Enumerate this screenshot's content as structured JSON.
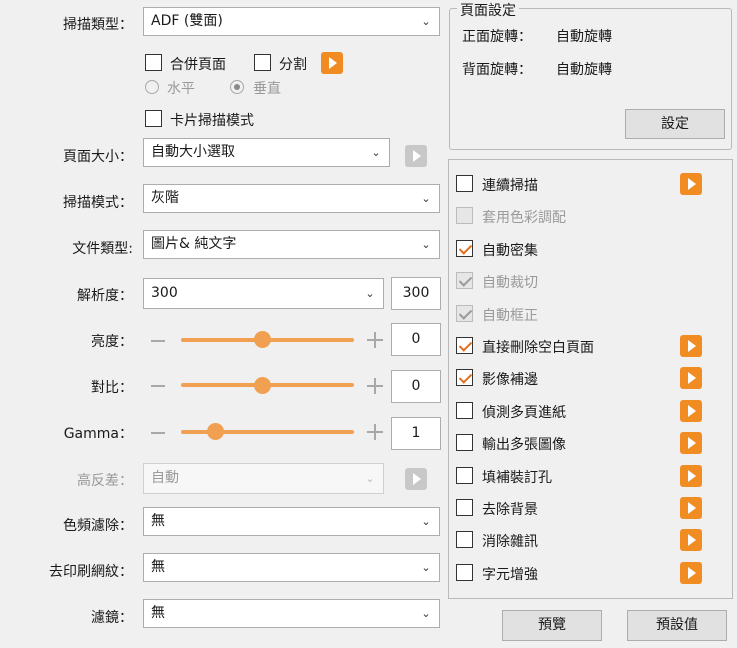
{
  "fields": {
    "scan_type": {
      "label": "掃描類型：",
      "value": "ADF (雙面)"
    },
    "page_size": {
      "label": "頁面大小：",
      "value": "自動大小選取"
    },
    "scan_mode": {
      "label": "掃描模式：",
      "value": "灰階"
    },
    "doc_type": {
      "label": "文件類型:",
      "value": "圖片& 純文字"
    },
    "resolution": {
      "label": "解析度：",
      "value": "300",
      "number": "300"
    },
    "brightness": {
      "label": "亮度：",
      "number": "0",
      "level_percent": 47
    },
    "contrast": {
      "label": "對比：",
      "number": "0",
      "level_percent": 47
    },
    "gamma": {
      "label": "Gamma：",
      "number": "1",
      "level_percent": 20
    },
    "high_contrast": {
      "label": "高反差：",
      "value": "自動"
    },
    "color_dropout": {
      "label": "色頻濾除：",
      "value": "無"
    },
    "descreen": {
      "label": "去印刷網紋：",
      "value": "無"
    },
    "filter": {
      "label": "濾鏡：",
      "value": "無"
    }
  },
  "options": {
    "merge_pages": "合併頁面",
    "split": "分割",
    "horizontal": "水平",
    "vertical": "垂直",
    "card_mode": "卡片掃描模式"
  },
  "page_setting": {
    "title": "頁面設定",
    "front_label": "正面旋轉：",
    "front_value": "自動旋轉",
    "back_label": "背面旋轉：",
    "back_value": "自動旋轉",
    "button": "設定"
  },
  "features": [
    {
      "label": "連續掃描",
      "checked": false,
      "disabled": false,
      "play": true
    },
    {
      "label": "套用色彩調配",
      "checked": false,
      "disabled": true,
      "play": false
    },
    {
      "label": "自動密集",
      "checked": true,
      "disabled": false,
      "play": false
    },
    {
      "label": "自動裁切",
      "checked": true,
      "disabled": true,
      "play": false
    },
    {
      "label": "自動框正",
      "checked": true,
      "disabled": true,
      "play": false
    },
    {
      "label": "直接刪除空白頁面",
      "checked": true,
      "disabled": false,
      "play": true
    },
    {
      "label": "影像補邊",
      "checked": true,
      "disabled": false,
      "play": true
    },
    {
      "label": "偵測多頁進紙",
      "checked": false,
      "disabled": false,
      "play": true
    },
    {
      "label": "輸出多張圖像",
      "checked": false,
      "disabled": false,
      "play": true
    },
    {
      "label": "填補裝訂孔",
      "checked": false,
      "disabled": false,
      "play": true
    },
    {
      "label": "去除背景",
      "checked": false,
      "disabled": false,
      "play": true
    },
    {
      "label": "消除雜訊",
      "checked": false,
      "disabled": false,
      "play": true
    },
    {
      "label": "字元增強",
      "checked": false,
      "disabled": false,
      "play": true
    }
  ],
  "buttons": {
    "preview": "預覽",
    "defaults": "預設值"
  },
  "icons": {
    "dropdown": "chevron-down-icon",
    "play": "play-icon",
    "checkbox": "checkbox-icon",
    "radio": "radio-icon",
    "minus": "minus-icon",
    "plus": "plus-icon"
  },
  "colors": {
    "accent": "#f08c22",
    "slider": "#f0a050",
    "check": "#e2701e",
    "disabled_text": "#9a9a9a"
  }
}
